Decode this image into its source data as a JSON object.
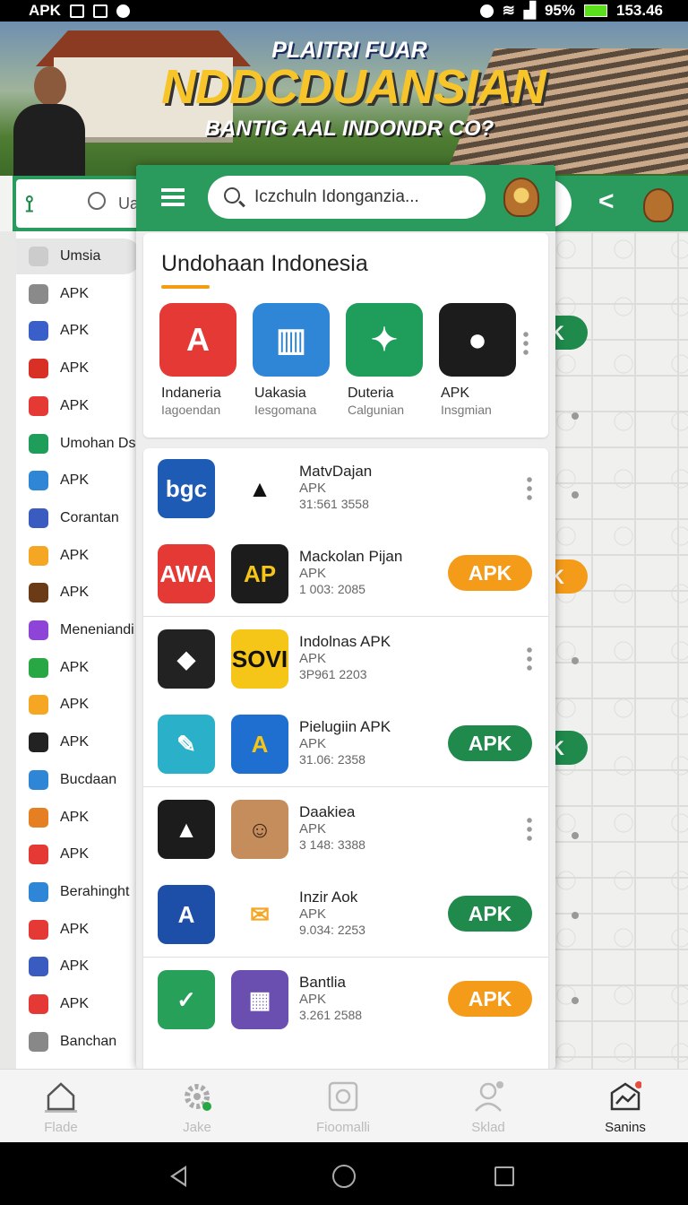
{
  "status_bar": {
    "left_label": "APK",
    "battery": "95%",
    "time": "153.46"
  },
  "banner": {
    "line1": "PLAITRI FUAR",
    "line2": "NDDCDUANSIAN",
    "line3": "BANTIG AAL INDONDR CO?"
  },
  "back_screen": {
    "search_text": "Uan",
    "sidebar_items": [
      {
        "label": "Umsia",
        "icon": "home-icon",
        "color": "#cccccc"
      },
      {
        "label": "APK",
        "icon": "warning-icon",
        "color": "#8a8a8a"
      },
      {
        "label": "APK",
        "icon": "puzzle-icon",
        "color": "#3b5fc9"
      },
      {
        "label": "APK",
        "icon": "check-icon",
        "color": "#d93025"
      },
      {
        "label": "APK",
        "icon": "card-icon",
        "color": "#e53935"
      },
      {
        "label": "Umohan Ds",
        "icon": "clock-icon",
        "color": "#1e9e5a"
      },
      {
        "label": "APK",
        "icon": "chat-icon",
        "color": "#2f86d6"
      },
      {
        "label": "Corantan",
        "icon": "gear-icon",
        "color": "#3a5bbf"
      },
      {
        "label": "APK",
        "icon": "spark-icon",
        "color": "#f5a623"
      },
      {
        "label": "APK",
        "icon": "face-icon",
        "color": "#6b3a16"
      },
      {
        "label": "Meneniandi",
        "icon": "circle-icon",
        "color": "#8e44d6"
      },
      {
        "label": "APK",
        "icon": "play-icon",
        "color": "#27a844"
      },
      {
        "label": "APK",
        "icon": "tag-icon",
        "color": "#f5a623"
      },
      {
        "label": "APK",
        "icon": "emblem-icon",
        "color": "#222222"
      },
      {
        "label": "Bucdaan",
        "icon": "figure-icon",
        "color": "#2f86d6"
      },
      {
        "label": "APK",
        "icon": "flower-icon",
        "color": "#e67e22"
      },
      {
        "label": "APK",
        "icon": "mail-icon",
        "color": "#e53935"
      },
      {
        "label": "Berahinght",
        "icon": "globe-icon",
        "color": "#2f86d6"
      },
      {
        "label": "APK",
        "icon": "camera-icon",
        "color": "#e53935"
      },
      {
        "label": "APK",
        "icon": "world-icon",
        "color": "#3a5bbf"
      },
      {
        "label": "APK",
        "icon": "briefcase-icon",
        "color": "#e53935"
      },
      {
        "label": "Banchan",
        "icon": "doc-icon",
        "color": "#888888"
      }
    ],
    "peek_buttons": [
      {
        "label": "K",
        "color": "#1f8a4c"
      },
      {
        "label": "K",
        "color": "#f59b1a"
      },
      {
        "label": "K",
        "color": "#1f8a4c"
      }
    ]
  },
  "panel": {
    "search_text": "Iczchuln Idonganzia...",
    "featured_title": "Undohaan Indonesia",
    "featured_apps": [
      {
        "name": "Indaneria",
        "sub": "Iagoendan",
        "icon": "letter-a-icon",
        "bg": "#e53935",
        "glyph": "A"
      },
      {
        "name": "Uakasia",
        "sub": "Iesgomana",
        "icon": "folders-icon",
        "bg": "#2f86d6",
        "glyph": "▥"
      },
      {
        "name": "Duteria",
        "sub": "Calgunian",
        "icon": "garuda-emblem-icon",
        "bg": "#1e9e5a",
        "glyph": "✦"
      },
      {
        "name": "APK",
        "sub": "Insgmian",
        "icon": "dark-emblem-icon",
        "bg": "#1c1c1c",
        "glyph": "●"
      }
    ],
    "list": [
      {
        "name": "MatvDajan",
        "tag": "APK",
        "num": "31:561 3558",
        "icon1": "bgc-logo-icon",
        "icon1_bg": "#1e5bb5",
        "icon1_glyph": "bgc",
        "icon2": "delta-logo-icon",
        "icon2_bg": "#ffffff",
        "icon2_fg": "#111111",
        "icon2_glyph": "▲",
        "button": null
      },
      {
        "name": "Mackolan Pijan",
        "tag": "APK",
        "num": "1 003: 2085",
        "icon1": "badge-logo-icon",
        "icon1_bg": "#e53935",
        "icon1_glyph": "AWA",
        "icon2": "ap-logo-icon",
        "icon2_bg": "#1c1c1c",
        "icon2_fg": "#f5c518",
        "icon2_glyph": "AP",
        "button": {
          "label": "APK",
          "color": "#f59b1a"
        }
      },
      {
        "name": "Indolnas APK",
        "tag": "APK",
        "num": "3P961 2203",
        "icon1": "puzzle-logo-icon",
        "icon1_bg": "#222222",
        "icon1_glyph": "◆",
        "icon2": "sovi-logo-icon",
        "icon2_bg": "#f5c518",
        "icon2_fg": "#111111",
        "icon2_glyph": "SOVI",
        "button": null
      },
      {
        "name": "Pielugiin APK",
        "tag": "APK",
        "num": "31.06: 2358",
        "icon1": "tool-logo-icon",
        "icon1_bg": "#2ab0c8",
        "icon1_glyph": "✎",
        "icon2": "aps-logo-icon",
        "icon2_bg": "#1e6fd0",
        "icon2_fg": "#f5c518",
        "icon2_glyph": "A",
        "button": {
          "label": "APK",
          "color": "#1f8a4c"
        }
      },
      {
        "name": "Daakiea",
        "tag": "APK",
        "num": "3 148: 3388",
        "icon1": "triangle-logo-icon",
        "icon1_bg": "#1c1c1c",
        "icon1_glyph": "▲",
        "icon2": "portrait-icon",
        "icon2_bg": "#c58c5c",
        "icon2_fg": "#3a2414",
        "icon2_glyph": "☺",
        "button": null
      },
      {
        "name": "Inzir Aok",
        "tag": "APK",
        "num": "9.034: 2253",
        "icon1": "apc-logo-icon",
        "icon1_bg": "#1e4fa8",
        "icon1_glyph": "A",
        "icon2": "envelope-icon",
        "icon2_bg": "#ffffff",
        "icon2_fg": "#f5a623",
        "icon2_glyph": "✉",
        "button": {
          "label": "APK",
          "color": "#1f8a4c"
        }
      },
      {
        "name": "Bantlia",
        "tag": "APK",
        "num": "3.261 2588",
        "icon1": "checkmark-logo-icon",
        "icon1_bg": "#27a05a",
        "icon1_glyph": "✓",
        "icon2": "collage-icon",
        "icon2_bg": "#6a4fb0",
        "icon2_fg": "#ffffff",
        "icon2_glyph": "▦",
        "button": {
          "label": "APK",
          "color": "#f59b1a"
        }
      }
    ]
  },
  "bottom_nav": [
    {
      "label": "Flade",
      "icon": "home-icon",
      "active": false
    },
    {
      "label": "Jake",
      "icon": "settings-icon",
      "active": false
    },
    {
      "label": "Fioomalli",
      "icon": "camera-icon",
      "active": false
    },
    {
      "label": "Sklad",
      "icon": "profile-icon",
      "active": false
    },
    {
      "label": "Sanins",
      "icon": "chart-icon",
      "active": true
    }
  ],
  "colors": {
    "primary_green": "#2a9b5c",
    "accent_orange": "#f59b1a",
    "underline_orange": "#f39c12"
  }
}
